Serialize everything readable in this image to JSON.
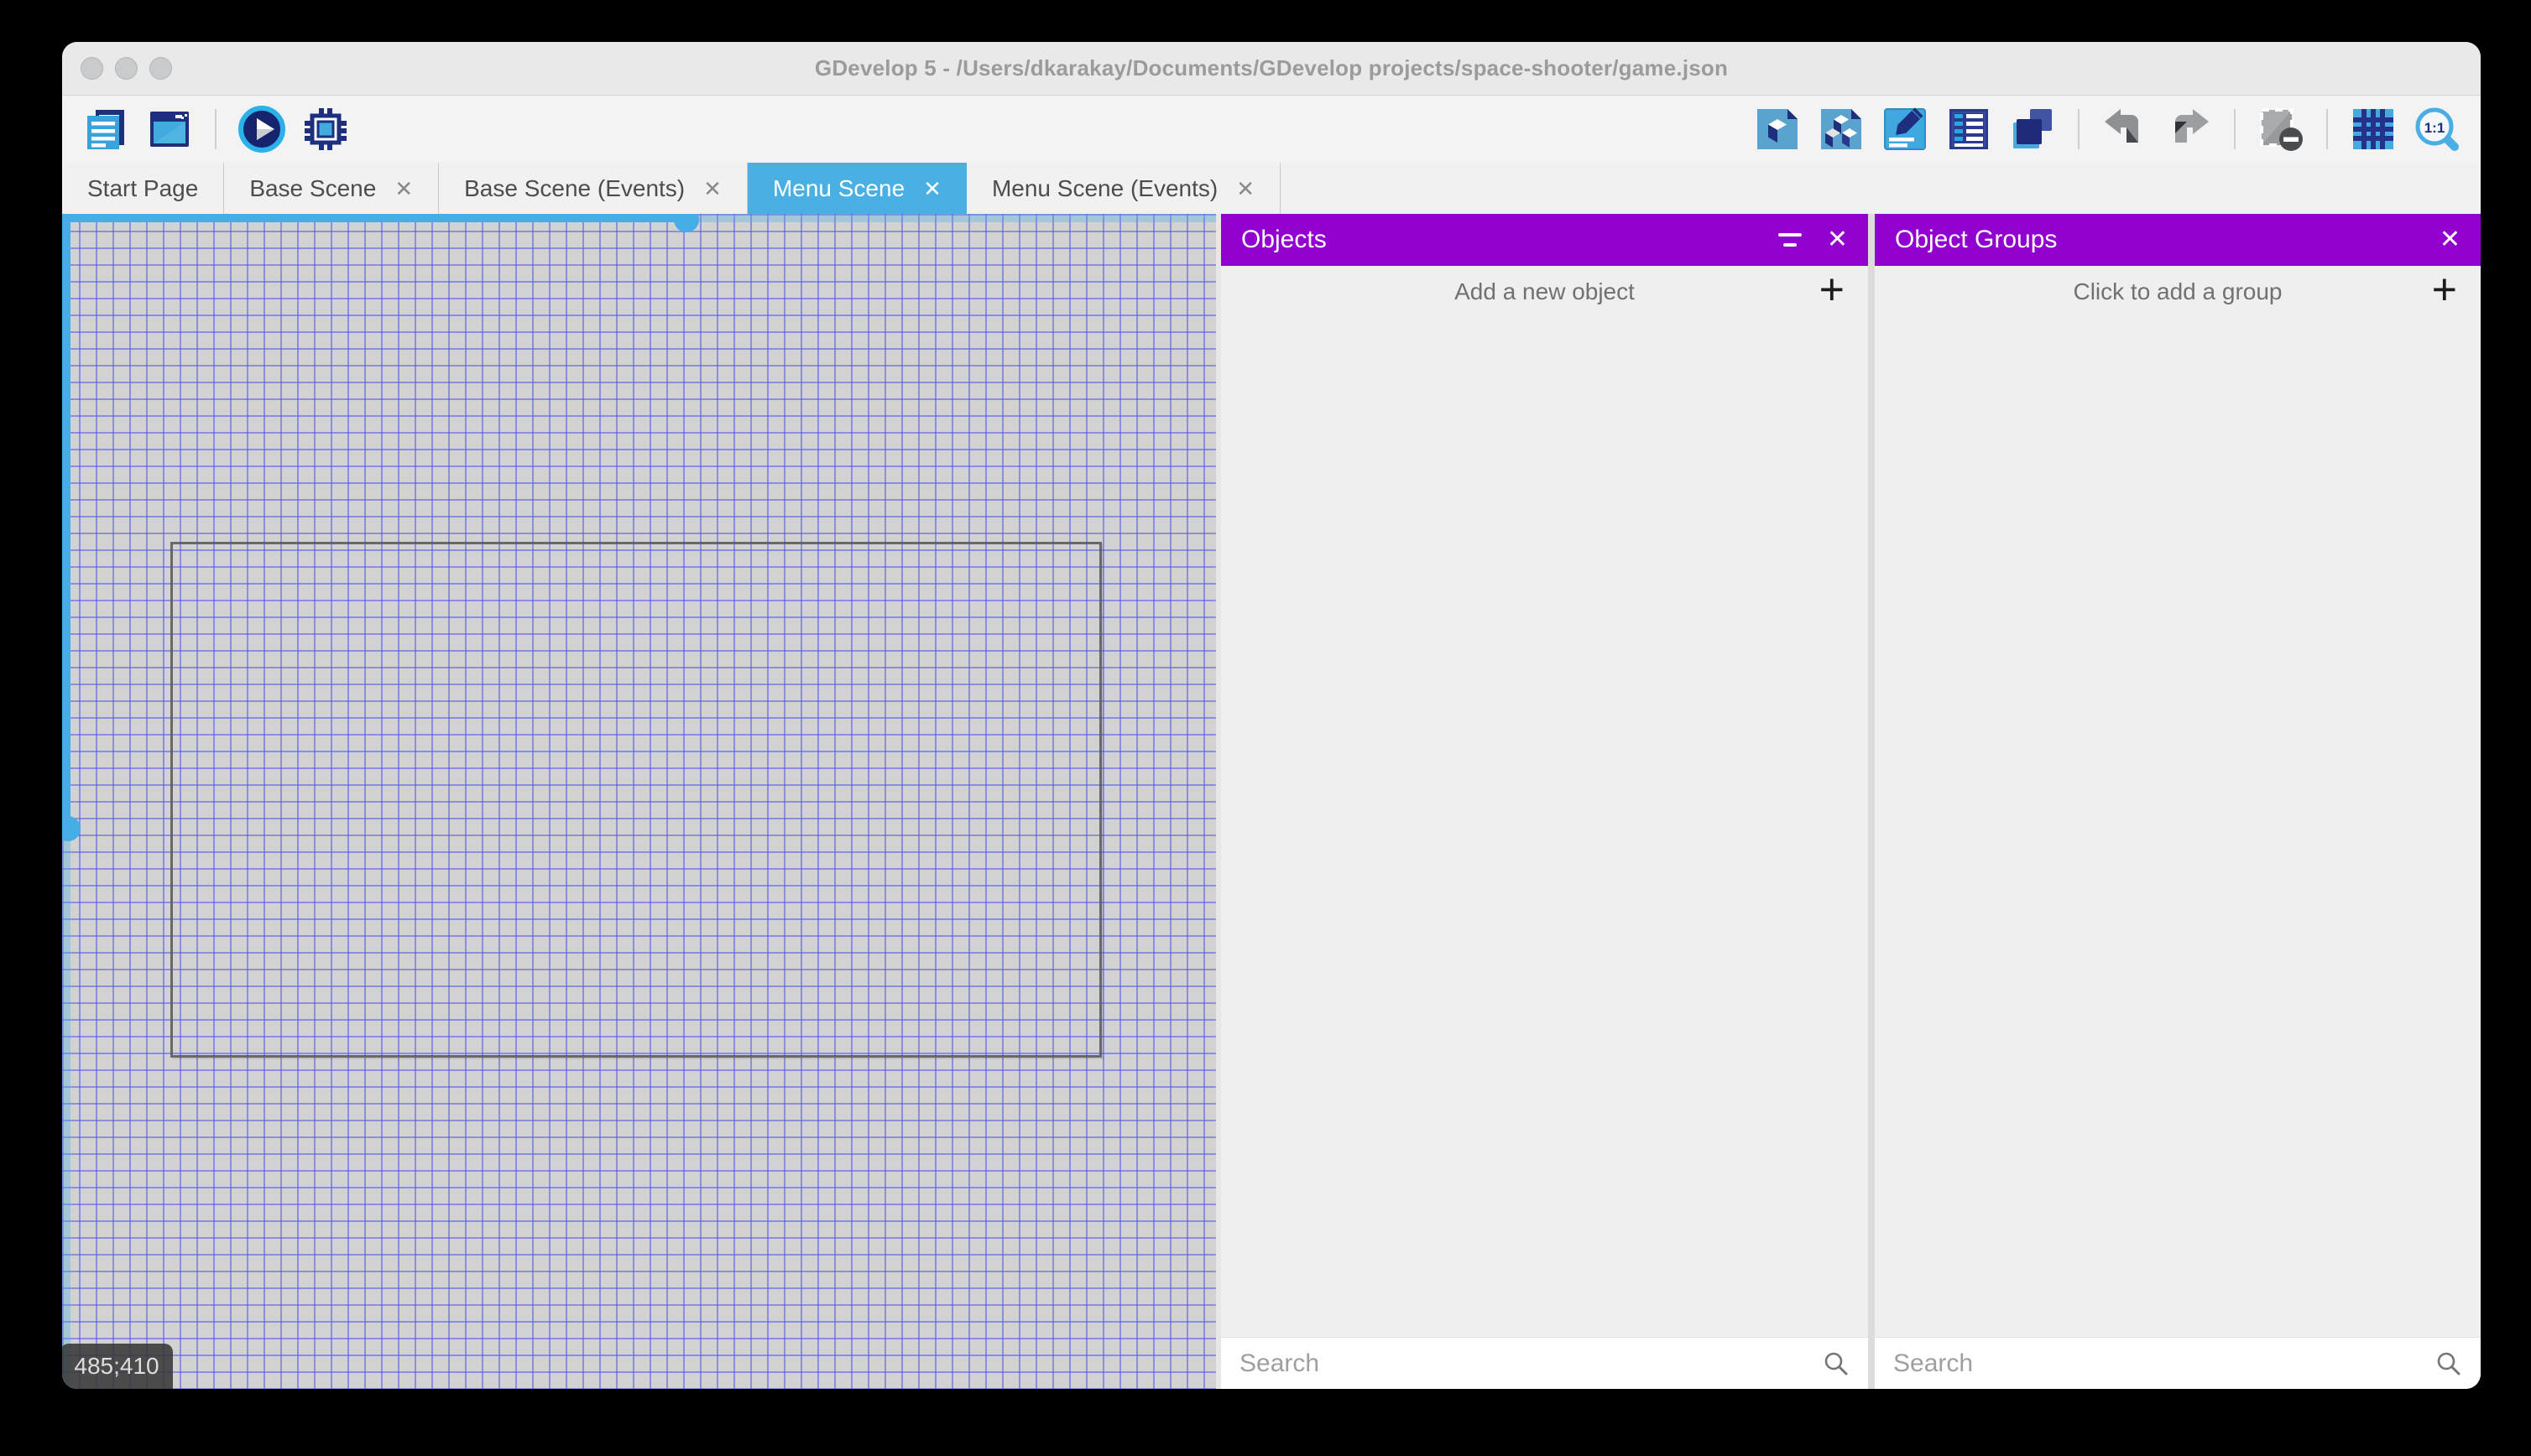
{
  "titlebar": {
    "title": "GDevelop 5 - /Users/dkarakay/Documents/GDevelop projects/space-shooter/game.json"
  },
  "toolbar": {
    "left_icons": [
      "project-manager-icon",
      "start-page-icon",
      "preview-play-icon",
      "debug-icon"
    ],
    "right_icons": [
      "objects-editor-icon",
      "object-groups-editor-icon",
      "properties-icon",
      "instances-list-icon",
      "layers-icon",
      "undo-icon",
      "redo-icon",
      "window-mask-icon",
      "grid-icon",
      "zoom-1-1-icon"
    ]
  },
  "tabs": {
    "items": [
      {
        "label": "Start Page",
        "closable": false,
        "active": false
      },
      {
        "label": "Base Scene",
        "closable": true,
        "active": false
      },
      {
        "label": "Base Scene (Events)",
        "closable": true,
        "active": false
      },
      {
        "label": "Menu Scene",
        "closable": true,
        "active": true
      },
      {
        "label": "Menu Scene (Events)",
        "closable": true,
        "active": false
      }
    ]
  },
  "canvas": {
    "cursor_coordinates": "485;410"
  },
  "panels": {
    "objects": {
      "title": "Objects",
      "add_label": "Add a new object",
      "search_placeholder": "Search"
    },
    "groups": {
      "title": "Object Groups",
      "add_label": "Click to add a group",
      "search_placeholder": "Search"
    }
  },
  "icons": {
    "close": "✕",
    "plus": "+"
  },
  "colors": {
    "accent_blue": "#4ab0e4",
    "header_purple": "#9100ce",
    "grid_line_blue": "#5656e8",
    "grid_background": "#d2d2d2",
    "scrollbar_blue": "#46aee6"
  }
}
